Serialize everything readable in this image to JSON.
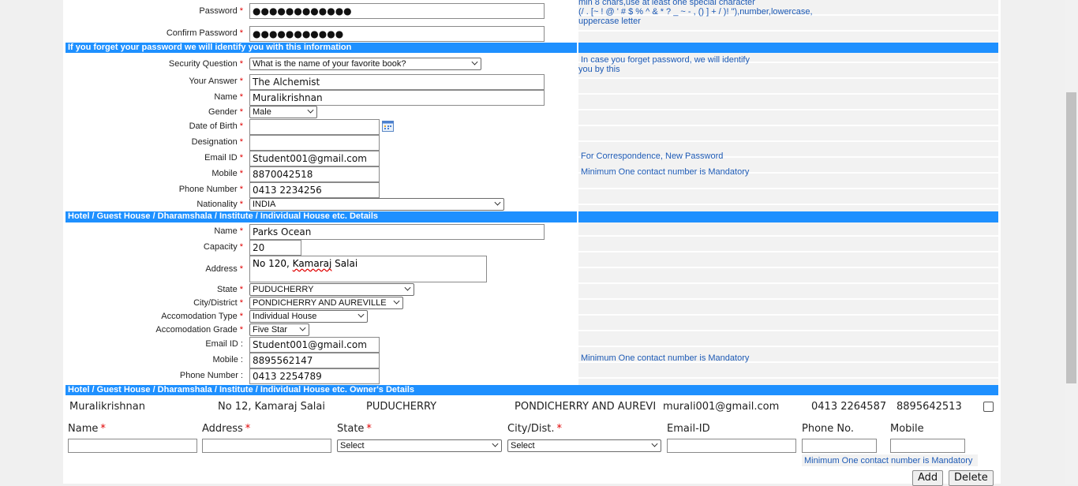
{
  "account": {
    "password_label": "Password",
    "password_value": "●●●●●●●●●●●●",
    "confirm_label": "Confirm Password",
    "confirm_value": "●●●●●●●●●●●",
    "password_help_line1": "min 8 chars,use at least one special character",
    "password_help_line2": "(/ . [~ ! @ ' # $ % ^ & * ? _ ~ - , () ] + / )! \"),number,lowercase,",
    "password_help_line3": "uppercase letter"
  },
  "security_band": "If you forget your password we will identify you with this information",
  "personal": {
    "security_question_label": "Security Question",
    "security_question_value": "What is the name of your favorite book?",
    "security_help_line1": "In case you forget password, we will identify",
    "security_help_line2": "you by this",
    "answer_label": "Your Answer",
    "answer_value": "The Alchemist",
    "name_label": "Name",
    "name_value": "Muralikrishnan",
    "gender_label": "Gender",
    "gender_value": "Male",
    "dob_label": "Date of Birth",
    "dob_value": "",
    "designation_label": "Designation",
    "designation_value": "",
    "email_label": "Email ID",
    "email_value": "Student001@gmail.com",
    "email_help": "For Correspondence, New Password",
    "mobile_label": "Mobile",
    "mobile_value": "8870042518",
    "mobile_help": "Minimum One contact number is Mandatory",
    "phone_label": "Phone Number",
    "phone_value": "0413 2234256",
    "nationality_label": "Nationality",
    "nationality_value": "INDIA"
  },
  "hotel_band": "Hotel / Guest House / Dharamshala / Institute / Individual House etc. Details",
  "hotel": {
    "name_label": "Name",
    "name_value": "Parks Ocean",
    "capacity_label": "Capacity",
    "capacity_value": "20",
    "address_label": "Address",
    "address_part1": "No 120, ",
    "address_part2": "Kamaraj",
    "address_part3": " Salai",
    "state_label": "State",
    "state_value": "PUDUCHERRY",
    "city_label": "City/District",
    "city_value": "PONDICHERRY AND AUREVILLE",
    "acc_type_label": "Accomodation Type",
    "acc_type_value": "Individual House",
    "acc_grade_label": "Accomodation Grade",
    "acc_grade_value": "Five Star",
    "email_label": "Email ID",
    "email_value": "Student001@gmail.com",
    "mobile_label": "Mobile",
    "mobile_value": "8895562147",
    "mobile_help": "Minimum One contact number is Mandatory",
    "phone_label": "Phone Number",
    "phone_value": "0413 2254789"
  },
  "owner_band": "Hotel / Guest House / Dharamshala / Institute / Individual House etc.  Owner's Details",
  "owner_row": {
    "name": "Muralikrishnan",
    "address": "No 12, Kamaraj Salai",
    "state": "PUDUCHERRY",
    "city": "PONDICHERRY AND AUREVILLE",
    "email": "murali001@gmail.com",
    "phone": "0413 2264587",
    "mobile": "8895642513"
  },
  "owner_headers": {
    "name": "Name",
    "address": "Address",
    "state": "State",
    "city": "City/Dist.",
    "email": "Email-ID",
    "phone": "Phone No.",
    "mobile": "Mobile"
  },
  "owner_inputs": {
    "state_select": "Select",
    "city_select": "Select",
    "help": "Minimum One contact number is Mandatory"
  },
  "buttons": {
    "add": "Add",
    "delete": "Delete"
  },
  "required_mark": "*",
  "colors": {
    "band": "#1e90ff",
    "help_text": "#1d5ab5",
    "required": "#e00000"
  }
}
